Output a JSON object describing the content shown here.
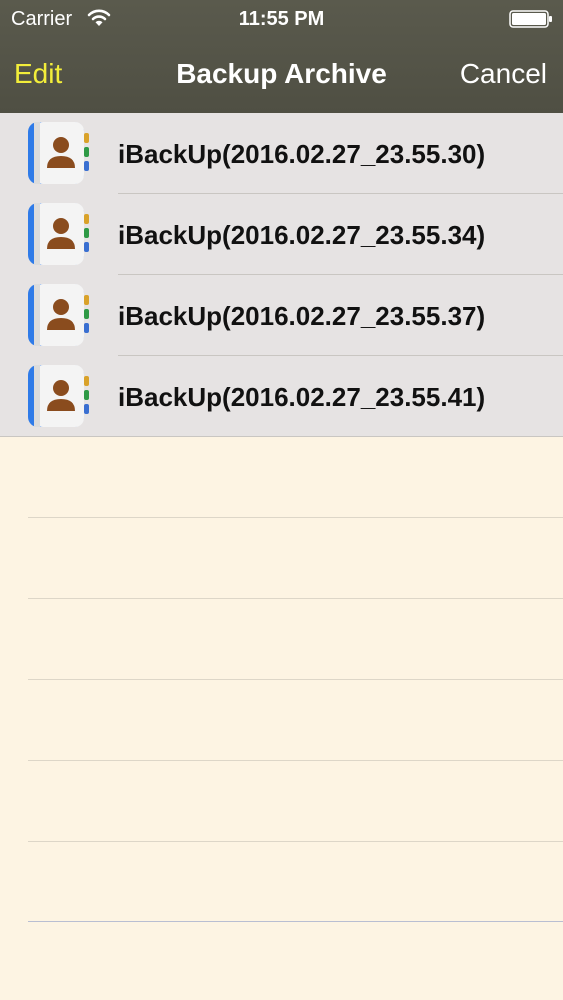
{
  "status_bar": {
    "carrier": "Carrier",
    "time": "11:55 PM",
    "wifi_icon": "wifi-icon",
    "battery_icon": "battery-icon"
  },
  "nav_bar": {
    "edit_label": "Edit",
    "title": "Backup Archive",
    "cancel_label": "Cancel",
    "edit_color": "#f3ee3a"
  },
  "backups": [
    {
      "label": "iBackUp(2016.02.27_23.55.30)",
      "icon": "contacts-book-icon"
    },
    {
      "label": "iBackUp(2016.02.27_23.55.34)",
      "icon": "contacts-book-icon"
    },
    {
      "label": "iBackUp(2016.02.27_23.55.37)",
      "icon": "contacts-book-icon"
    },
    {
      "label": "iBackUp(2016.02.27_23.55.41)",
      "icon": "contacts-book-icon"
    }
  ],
  "colors": {
    "nav_background": "#55554a",
    "row_background": "#e6e3e3",
    "paper_background": "#fdf4e3"
  }
}
